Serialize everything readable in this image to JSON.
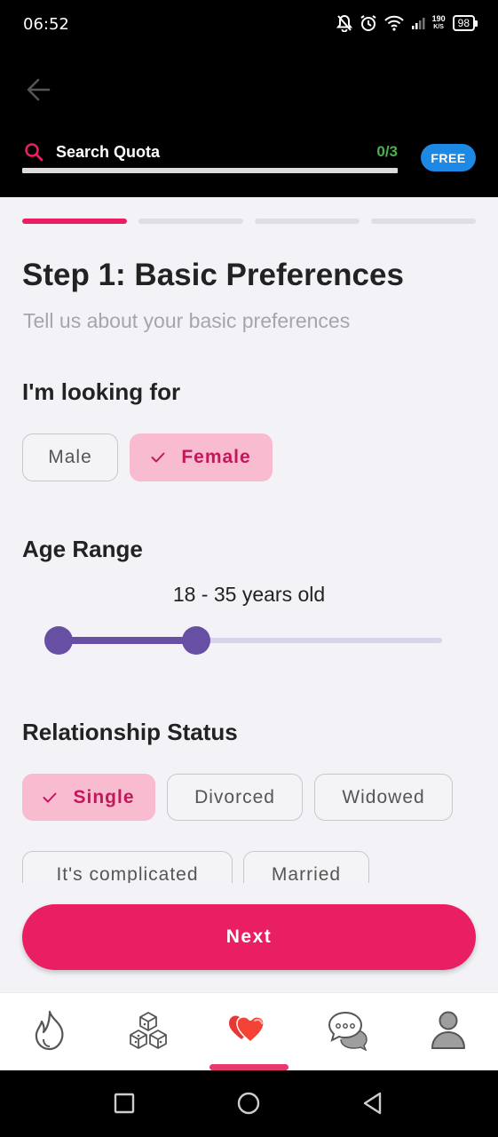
{
  "status_bar": {
    "time": "06:52",
    "net_speed_value": "190",
    "net_speed_unit": "K/S",
    "battery": "98"
  },
  "header": {
    "search_label": "Search Quota",
    "quota_count": "0/3",
    "badge": "FREE",
    "progress_fraction": 0
  },
  "steps": {
    "total": 4,
    "current": 1
  },
  "page": {
    "title": "Step 1: Basic Preferences",
    "subtitle": "Tell us about your basic preferences"
  },
  "looking_for": {
    "heading": "I'm looking for",
    "options": [
      {
        "label": "Male",
        "selected": false
      },
      {
        "label": "Female",
        "selected": true
      }
    ]
  },
  "age_range": {
    "heading": "Age Range",
    "value_text": "18 - 35 years old",
    "min_selected": 18,
    "max_selected": 35
  },
  "relationship_status": {
    "heading": "Relationship Status",
    "options": [
      {
        "label": "Single",
        "selected": true
      },
      {
        "label": "Divorced",
        "selected": false
      },
      {
        "label": "Widowed",
        "selected": false
      },
      {
        "label": "It's complicated",
        "selected": false
      },
      {
        "label": "Married",
        "selected": false
      }
    ]
  },
  "next_button": "Next",
  "bottom_nav": {
    "items": [
      "flame-icon",
      "cubes-icon",
      "hearts-icon",
      "chat-icon",
      "profile-icon"
    ],
    "active_index": 2
  },
  "colors": {
    "accent": "#e91e63",
    "chip_selected_bg": "#f8bbd0",
    "slider": "#6750a4",
    "badge": "#1e88e5",
    "quota_count": "#4caf50"
  }
}
